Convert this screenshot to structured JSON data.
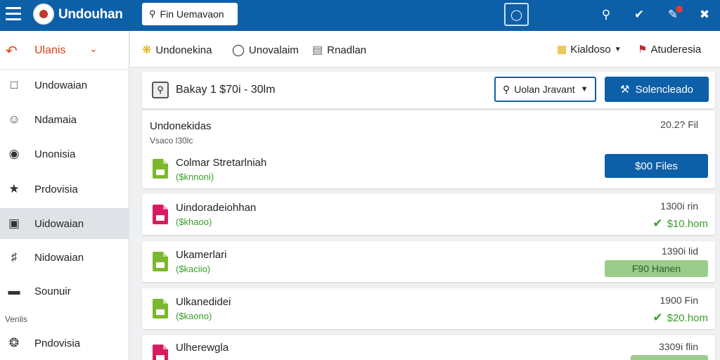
{
  "app": {
    "title": "Undouhan"
  },
  "top_search": {
    "value": "Fin Uemavaon"
  },
  "sidebar": {
    "back": {
      "label": "Ulanis"
    },
    "items": [
      {
        "label": "Undowaian",
        "icon": "square-icon"
      },
      {
        "label": "Ndamaia",
        "icon": "users-icon"
      },
      {
        "label": "Unonisia",
        "icon": "location-pin-icon"
      },
      {
        "label": "Prdovisia",
        "icon": "star-icon"
      },
      {
        "label": "Uidowaian",
        "icon": "folder-icon"
      },
      {
        "label": "Nidowaian",
        "icon": "group-icon"
      },
      {
        "label": "Sounuir",
        "icon": "box-icon"
      }
    ],
    "section_label": "Venlis",
    "bottom_item": {
      "label": "Pndovisia",
      "icon": "soccer-icon"
    },
    "active_index": 4
  },
  "subbar": {
    "tabs": [
      {
        "label": "Undonekina",
        "icon": "gear-icon"
      },
      {
        "label": "Unovalaim",
        "icon": "circle-icon"
      },
      {
        "label": "Rnadlan",
        "icon": "list-icon"
      }
    ],
    "right": [
      {
        "label": "Kialdoso",
        "icon": "badge-icon"
      },
      {
        "label": "Atuderesia",
        "icon": "flag-icon"
      }
    ]
  },
  "panel": {
    "query": "Bakay 1 $70i - 30lm",
    "dropdown": "Uolan Jravant",
    "primary_button": "Solencleado"
  },
  "first_card": {
    "title": "Undonekidas",
    "subtitle": "Vsaco l30lc",
    "right": "20.2? Fil",
    "file_name": "Colmar Stretarlniah",
    "file_size": "($knnoni)",
    "button": "$00 Files"
  },
  "rows": [
    {
      "name": "Uindoradeiohhan",
      "size": "($khaoo)",
      "time": "1300i rin",
      "status": "$10.hom",
      "status_type": "check",
      "color": "pink"
    },
    {
      "name": "Ukamerlari",
      "size": "($kaciio)",
      "time": "1390i lid",
      "status": "F90 Hanen",
      "status_type": "pill",
      "color": "green"
    },
    {
      "name": "Ulkanedidei",
      "size": "($kaono)",
      "time": "1900 Fin",
      "status": "$20.hom",
      "status_type": "check",
      "color": "green"
    },
    {
      "name": "Ulherewgla",
      "size": "",
      "time": "3309i flin",
      "status": "",
      "status_type": "pill",
      "color": "pink"
    }
  ]
}
